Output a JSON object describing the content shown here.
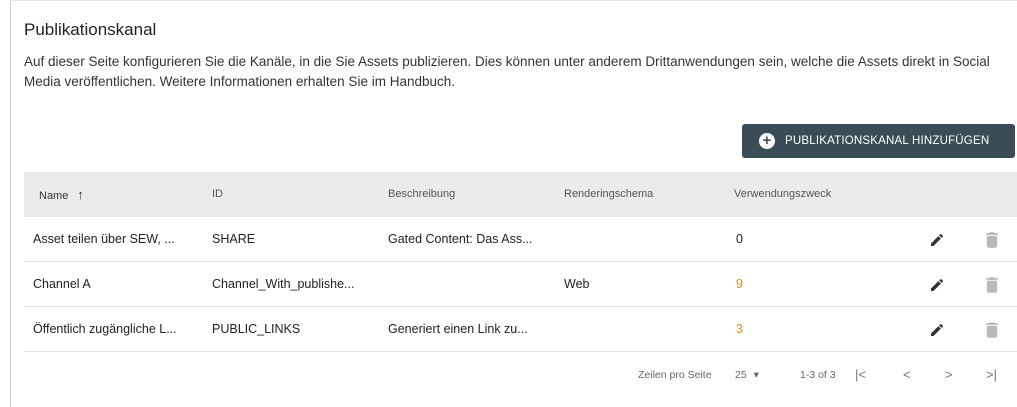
{
  "page": {
    "title": "Publikationskanal",
    "description": "Auf dieser Seite konfigurieren Sie die Kanäle, in die Sie Assets publizieren. Dies können unter anderem Drittanwendungen sein, welche die Assets direkt in Social Media veröffentlichen. Weitere Informationen erhalten Sie im Handbuch."
  },
  "toolbar": {
    "add_label": "PUBLIKATIONSKANAL HINZUFÜGEN",
    "add_icon": "plus-circle-icon"
  },
  "table": {
    "columns": {
      "name": "Name",
      "sort_indicator": "↑",
      "id": "ID",
      "description": "Beschreibung",
      "rendering": "Renderingschema",
      "usage": "Verwendungszweck"
    },
    "rows": [
      {
        "name": "Asset teilen über SEW, ...",
        "id": "SHARE",
        "description": "Gated Content: Das Ass...",
        "rendering": "",
        "usage": "0"
      },
      {
        "name": "Channel A",
        "id": "Channel_With_publishe...",
        "description": "",
        "rendering": "Web",
        "usage": "9"
      },
      {
        "name": "Öffentlich zugängliche L...",
        "id": "PUBLIC_LINKS",
        "description": "Generiert einen Link zu...",
        "rendering": "",
        "usage": "3"
      }
    ]
  },
  "pagination": {
    "rows_per_page_label": "Zeilen pro Seite",
    "rows_per_page_value": "25",
    "dropdown_icon": "▾",
    "range": "1-3 of 3",
    "first": "|<",
    "prev": "<",
    "next": ">",
    "last": ">|"
  },
  "colors": {
    "accent_button": "#3a4d57",
    "usage_highlight": "#e8891e",
    "header_bg": "#ebebeb"
  }
}
